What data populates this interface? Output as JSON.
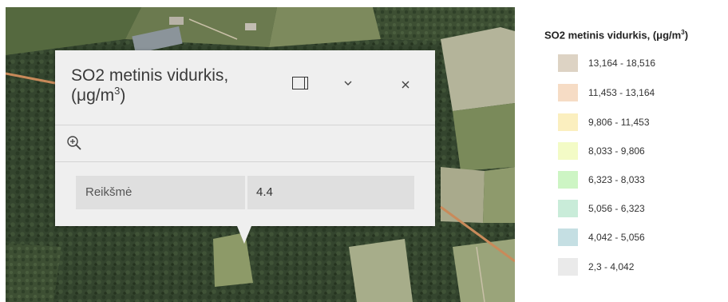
{
  "map": {
    "imagery": "satellite",
    "road_color": "#c98a5a"
  },
  "popup": {
    "title": "SO2 metinis vidurkis, (μg/m",
    "title_sup": "3",
    "title_end": ")",
    "icons": {
      "dock": "dock-icon",
      "collapse": "chevron-down-icon",
      "close": "close-icon",
      "zoom": "zoom-in-icon"
    },
    "attributes": [
      {
        "key": "Reikšmė",
        "value": "4.4"
      }
    ]
  },
  "legend": {
    "title": "SO2 metinis vidurkis, (μg/m",
    "title_sup": "3",
    "title_end": ")",
    "items": [
      {
        "range": "13,164 - 18,516",
        "color": "#ddd3c4"
      },
      {
        "range": "11,453 - 13,164",
        "color": "#f6dcc5"
      },
      {
        "range": "9,806 - 11,453",
        "color": "#fbefbf"
      },
      {
        "range": "8,033 - 9,806",
        "color": "#f3fbc6"
      },
      {
        "range": "6,323 - 8,033",
        "color": "#cdf5c4"
      },
      {
        "range": "5,056 - 6,323",
        "color": "#c9ecd9"
      },
      {
        "range": "4,042 - 5,056",
        "color": "#c5dfe3"
      },
      {
        "range": "2,3 - 4,042",
        "color": "#eaeaea"
      }
    ]
  }
}
